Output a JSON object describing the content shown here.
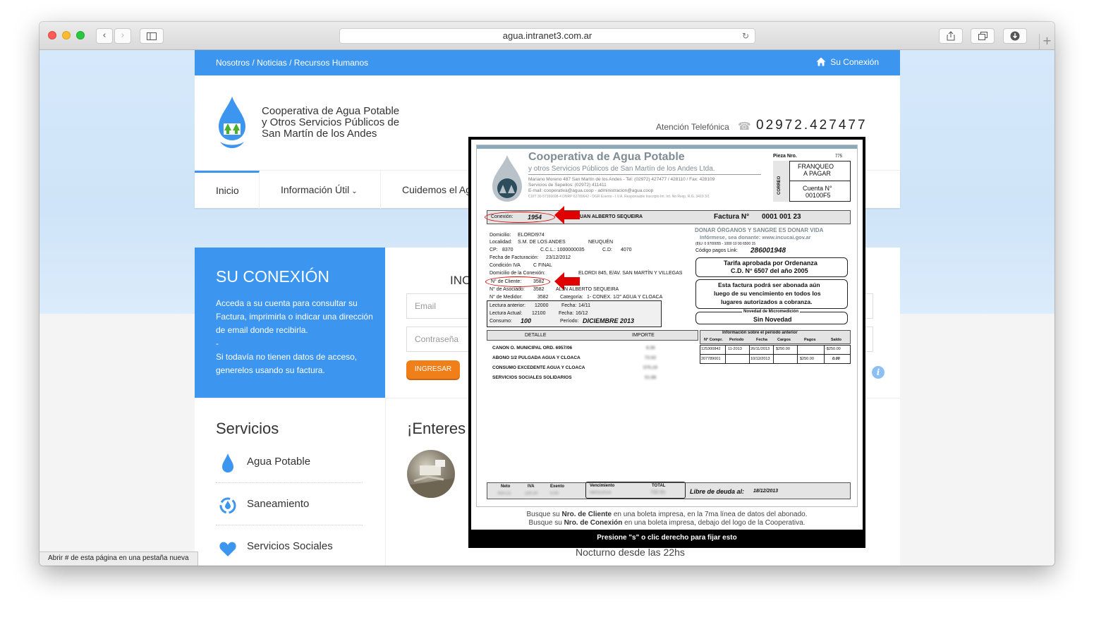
{
  "browser": {
    "url": "agua.intranet3.com.ar",
    "status_text": "Abrir # de esta página en una pestaña nueva"
  },
  "topnav": {
    "links": [
      "Nosotros",
      "Noticias",
      "Recursos Humanos"
    ],
    "separator": "/",
    "su_conexion": "Su Conexión"
  },
  "header": {
    "org_line1": "Cooperativa de Agua Potable",
    "org_line2": "y Otros Servicios Públicos de",
    "org_line3": "San Martín de los Andes",
    "phone_label": "Atención Telefónica",
    "phone_number": "02972.427477"
  },
  "mainnav": {
    "items": [
      "Inicio",
      "Información Útil",
      "Cuidemos el Ag"
    ]
  },
  "conexion": {
    "title": "SU CONEXIÓN",
    "text1": "Acceda a su cuenta para consultar su Factura, imprimirla o indicar una dirección de email donde recibirla.",
    "dash": "-",
    "text2": "Si todavía no tienen datos de acceso, generelos usando su factura."
  },
  "login": {
    "title_partial": "INC",
    "email_placeholder": "Email",
    "password_placeholder": "Contraseña",
    "button": "INGRESAR"
  },
  "servicios": {
    "title": "Servicios",
    "items": [
      "Agua Potable",
      "Saneamiento",
      "Servicios Sociales"
    ]
  },
  "news": {
    "title_partial": "¡Enteres"
  },
  "nocturno": "Nocturno desde las 22hs",
  "popup": {
    "footer": "Presione \"s\" o clic derecho para fijar esto",
    "hint1_pre": "Busque su",
    "hint1_bold": "Nro. de Cliente",
    "hint1_post": "en una boleta impresa, en la 7ma línea de datos del abonado.",
    "hint2_pre": "Busque su",
    "hint2_bold": "Nro. de Conexión",
    "hint2_post": "en una boleta impresa, debajo del logo de la Cooperativa."
  },
  "bill": {
    "title": "Cooperativa de Agua Potable",
    "subtitle": "y otros Servicios Públicos de San Martín de los Andes Ltda.",
    "address": "Mariano Moreno 487 San Martín de los Andes - Tel: (02972) 427477 / 428110 / Fax: 428109",
    "sepelios": "Servicios de Sepelios: (02972) 411411",
    "email": "E-mail: cooperativa@agua.coop - administracion@agua.coop",
    "cuit": "CUIT 30-57166698-4 DNRP 62789642 - DGR Exento - I.V.A. Responsable Inscripto Im. Int. No Resp. R.G. 3419 3/1",
    "pieza_label": "Pieza Nro.",
    "pieza_num": "775",
    "franqueo": "FRANQUEO",
    "a_pagar": "A PAGAR",
    "correo": "CORREO",
    "cuenta_label": "Cuenta N°",
    "cuenta_num": "00100F5",
    "conexion_label": "Conexión:",
    "conexion_num": "1954",
    "titular": "UAN ALBERTO SEQUEIRA",
    "factura_label": "Factura N°",
    "factura_num": "0001 001 23",
    "domicilio": "Domicilio:",
    "domicilio_val": "ELORDI974",
    "localidad": "Localidad:",
    "localidad_val": "S.M. DE LOS ANDES",
    "provincia": "NEUQUÉN",
    "cp": "CP:",
    "cp_val": "8370",
    "ccl": "C.C.L.: 1000000035",
    "cd": "C.D:",
    "cd_val": "4070",
    "fecha_fact": "Fecha de Facturación:",
    "fecha_fact_val": "23/12/2012",
    "cond_iva": "Condición IVA",
    "cond_iva_val": "C FINAL",
    "dom_conexion": "Domicilio de la Conexión:",
    "dom_conexion_val": "ELORDI 845, E/AV. SAN MARTÍN Y VILLEGAS",
    "cliente_label": "N° de Cliente:",
    "cliente_num": "3582",
    "asociado": "N° de Asociado:",
    "asociado_val": "3582",
    "asociado_name": "ALJN ALBERTO SEQUEIRA",
    "medidor": "N° de Medidor:",
    "medidor_val": "3582",
    "categoria": "Categoría:",
    "categoria_val": "1- CONEX. 1/2\" AGUA Y CLOACA",
    "lect_ant": "Lectura anterior:",
    "lect_ant_val": "12000",
    "lect_ant_fecha": "Fecha:",
    "lect_ant_fecha_val": "14/11",
    "lect_act": "Lectura Actual:",
    "lect_act_val": "12100",
    "lect_act_fecha": "Fecha:",
    "lect_act_fecha_val": "16/12",
    "consumo": "Consumo:",
    "consumo_val": "100",
    "periodo": "Período:",
    "periodo_val": "DICIEMBRE 2013",
    "donar": "DONAR ÓRGANOS Y SANGRE ES DONAR VIDA",
    "informese": "Infórmese, sea donante: www.incucai.gov.ar",
    "barcode_code": "(8)U: 0 9700055 - 1000 10 90 6500 15",
    "pagoslink_label": "Código pagos Link:",
    "pagoslink_val": "286001948",
    "tarifa1": "Tarifa aprobada por Ordenanza",
    "tarifa2": "C.D. N° 6507 del año 2005",
    "abonada1": "Esta factura podrá ser abonada aún",
    "abonada2": "luego de su vencimiento en todos los",
    "abonada3": "lugares autorizados a cobranza.",
    "novedad_label": "Novedad de Micromedición",
    "novedad_val": "Sin Novedad",
    "detalle_h": "DETALLE",
    "importe_h": "IMPORTE",
    "detalle_items": [
      "CANON O. MUNICIPAL ORD. 6957/06",
      "ABONO 1/2 PULGADA AGUA Y CLOACA",
      "CONSUMO EXCEDENTE AGUA Y CLOACA",
      "SERVICIOS SOCIALES SOLIDARIOS"
    ],
    "importe_items": [
      "8.36",
      "72.62",
      "575.19",
      "51.88"
    ],
    "prev_title": "Información sobre el período anterior",
    "prev_headers": [
      "N° Compr.",
      "Período",
      "Fecha",
      "Cargos",
      "Pagos",
      "Saldo"
    ],
    "prev_row1": [
      "125300842",
      "11-2013",
      "26/11/2013",
      "$250.00",
      "",
      "-$250.00"
    ],
    "prev_row2": [
      "207789001",
      "",
      "10/12/2013",
      "",
      "$250.00",
      "0.00"
    ],
    "neto": "Neto",
    "iva": "IVA",
    "exento": "Exento",
    "vencimiento": "Vencimiento",
    "total": "TOTAL",
    "neto_val": "610.21",
    "iva_val": "120.20",
    "exento_val": "0.00",
    "venc_val": "08/01/2014",
    "total_val": "732.91",
    "libre_label": "Libre de deuda al:",
    "libre_val": "18/12/2013"
  }
}
